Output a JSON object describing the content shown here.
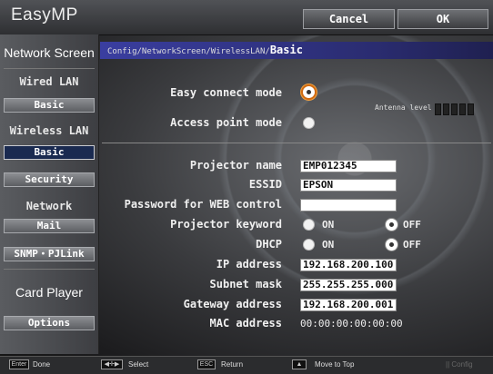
{
  "header": {
    "app_title": "EasyMP",
    "cancel_label": "Cancel",
    "ok_label": "OK"
  },
  "sidebar": {
    "network_screen": "Network Screen",
    "wired_lan": "Wired LAN",
    "wired_basic": "Basic",
    "wireless_lan": "Wireless LAN",
    "wireless_basic": "Basic",
    "security": "Security",
    "network": "Network",
    "mail": "Mail",
    "snmp": "SNMP・PJLink",
    "card_player": "Card Player",
    "options": "Options"
  },
  "breadcrumb": {
    "path": "Config/NetworkScreen/WirelessLAN/",
    "current": "Basic"
  },
  "form": {
    "easy_connect_label": "Easy connect mode",
    "access_point_label": "Access point mode",
    "antenna_label": "Antenna level",
    "projector_name_label": "Projector name",
    "projector_name_value": "EMP012345",
    "essid_label": "ESSID",
    "essid_value": "EPSON",
    "password_label": "Password for WEB control",
    "password_value": "",
    "keyword_label": "Projector keyword",
    "dhcp_label": "DHCP",
    "on_label": "ON",
    "off_label": "OFF",
    "ip_label": "IP address",
    "ip_value": "192.168.200.100",
    "subnet_label": "Subnet mask",
    "subnet_value": "255.255.255.000",
    "gateway_label": "Gateway address",
    "gateway_value": "192.168.200.001",
    "mac_label": "MAC address",
    "mac_value": "00:00:00:00:00:00"
  },
  "footer": {
    "enter_key": "Enter",
    "done": "Done",
    "select_key": "◀✛▶",
    "select": "Select",
    "esc_key": "ESC",
    "return": "Return",
    "top_key": "▲",
    "move_to_top": "Move to Top",
    "config": "Config"
  },
  "colors": {
    "accent": "#2a2c70",
    "focus": "#d06a10"
  }
}
